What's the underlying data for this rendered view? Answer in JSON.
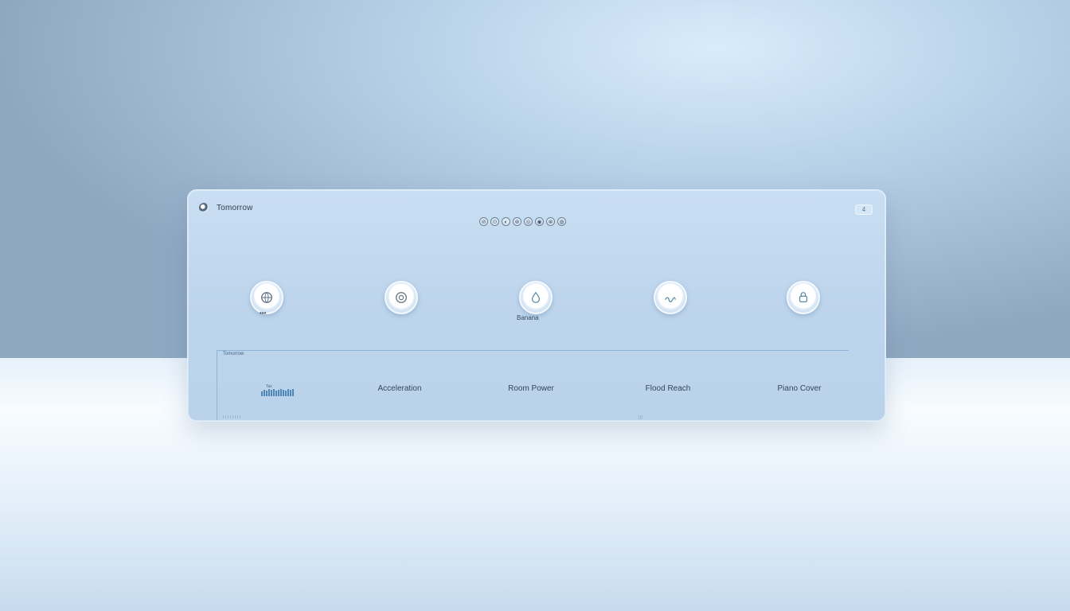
{
  "window": {
    "title": "Tomorrow"
  },
  "toolbar": {
    "tools": [
      "⊘",
      "⊙",
      "◐",
      "⊛",
      "◎",
      "◉",
      "⊗",
      "◍"
    ]
  },
  "corner_button": {
    "label": "4"
  },
  "icons": [
    {
      "name": "globe-icon",
      "caption": "•••"
    },
    {
      "name": "target-icon",
      "caption": ""
    },
    {
      "name": "drop-icon",
      "caption": "Banana"
    },
    {
      "name": "wave-icon",
      "caption": ""
    },
    {
      "name": "lock-icon",
      "caption": ""
    }
  ],
  "section": {
    "label": "Tomorrow"
  },
  "columns": [
    {
      "label": ""
    },
    {
      "label": "Acceleration"
    },
    {
      "label": "Room Power"
    },
    {
      "label": "Flood Reach"
    },
    {
      "label": "Piano Cover"
    }
  ],
  "mini_chart": {
    "label": "Tax"
  },
  "colors": {
    "accent": "#4f86b8",
    "panel": "#bcd4ec",
    "text": "#354556"
  }
}
